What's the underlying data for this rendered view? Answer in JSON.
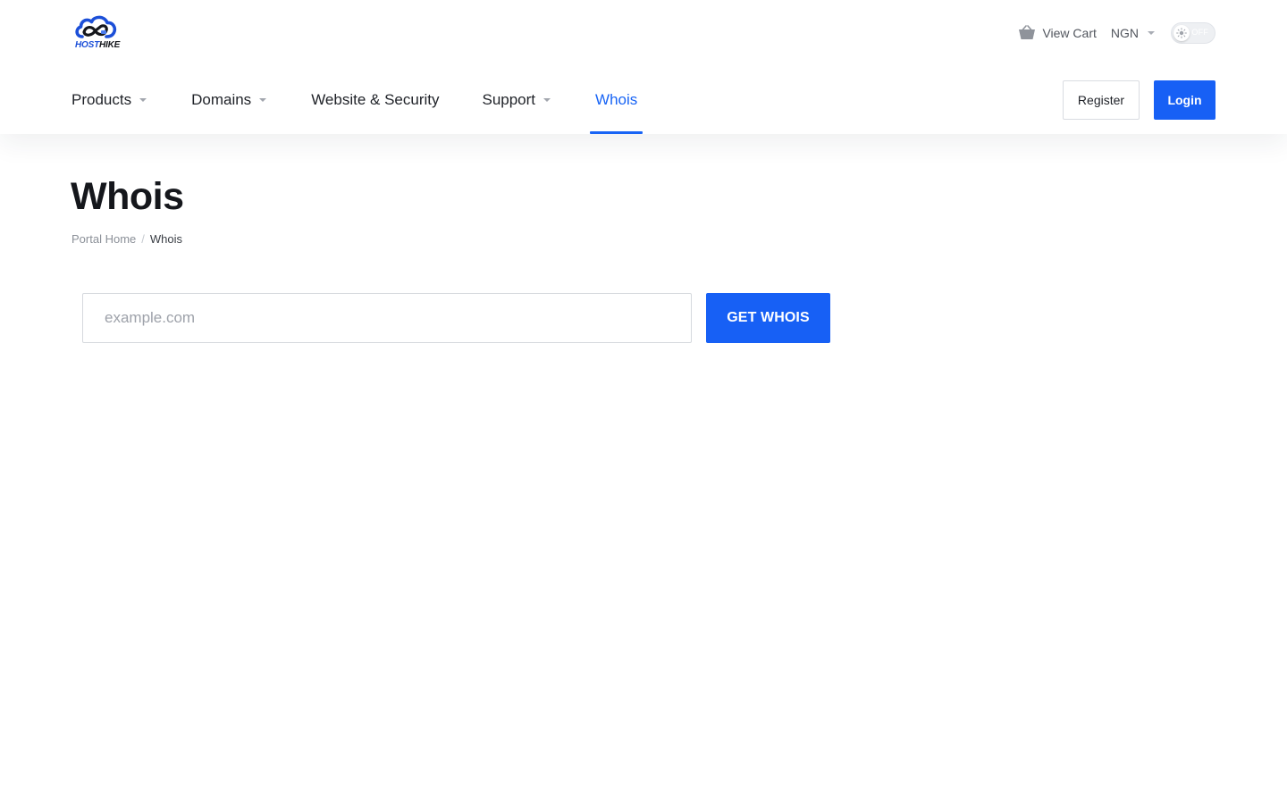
{
  "brand": {
    "name_part1": "HOST",
    "name_part2": "HIKE",
    "colors": {
      "primary": "#1760f5",
      "logo_blue": "#1c4fd8",
      "logo_dark": "#15171c"
    }
  },
  "top_bar": {
    "cart": {
      "icon": "basket-icon",
      "label": "View Cart"
    },
    "currency": {
      "selected": "NGN",
      "icon": "caret-down-icon"
    },
    "theme_toggle": {
      "icon": "sun-icon",
      "state_label": "OFF"
    }
  },
  "nav": {
    "items": [
      {
        "label": "Products",
        "has_dropdown": true
      },
      {
        "label": "Domains",
        "has_dropdown": true
      },
      {
        "label": "Website & Security",
        "has_dropdown": false
      },
      {
        "label": "Support",
        "has_dropdown": true
      },
      {
        "label": "Whois",
        "has_dropdown": false,
        "active": true
      }
    ]
  },
  "auth": {
    "register_label": "Register",
    "login_label": "Login"
  },
  "page": {
    "title": "Whois",
    "breadcrumb": [
      {
        "label": "Portal Home"
      },
      {
        "label": "Whois",
        "current": true
      }
    ],
    "separator": "/"
  },
  "whois_form": {
    "input_value": "",
    "input_placeholder": "example.com",
    "submit_label": "GET WHOIS"
  }
}
